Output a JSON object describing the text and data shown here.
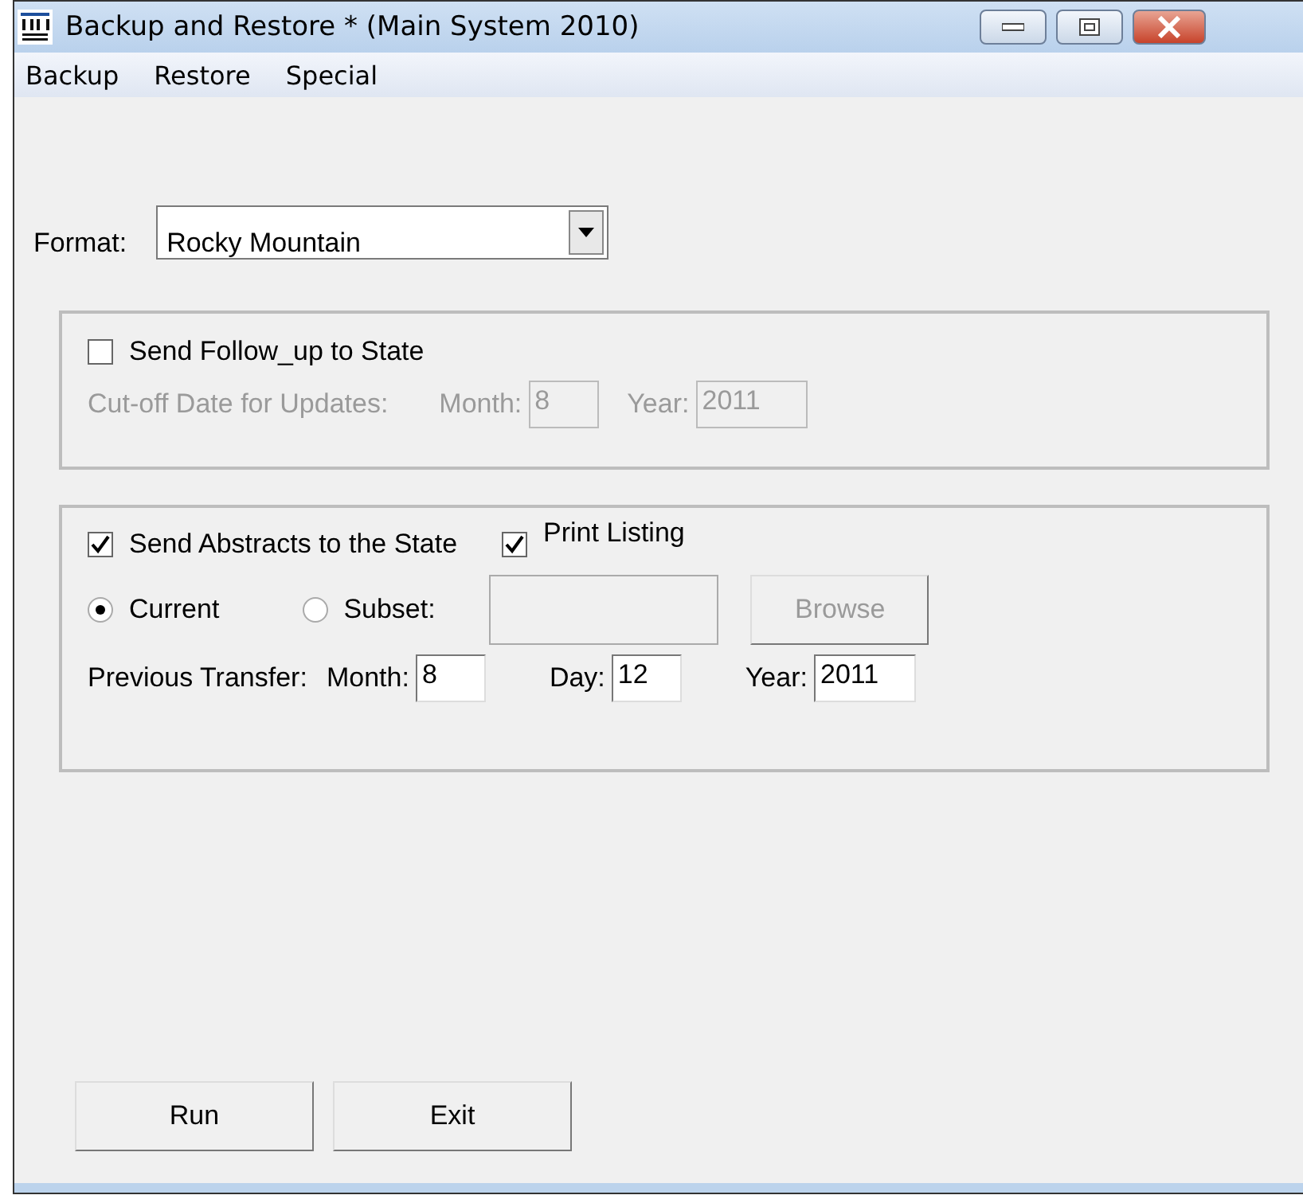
{
  "window": {
    "title": "Backup and Restore *  (Main System 2010)"
  },
  "menu": [
    "Backup",
    "Restore",
    "Special"
  ],
  "format": {
    "label": "Format:",
    "value": "Rocky Mountain"
  },
  "follow_up": {
    "label": "Send Follow_up to State",
    "checked": false,
    "date_row": {
      "label": "Cut-off Date for Updates:",
      "disabled": true,
      "fields": [
        {
          "label": "Month:",
          "value": "8"
        },
        {
          "label": "Year:",
          "value": "2011"
        }
      ]
    }
  },
  "abstracts": {
    "send": {
      "label": "Send Abstracts to the State",
      "checked": true
    },
    "print": {
      "label": "Print Listing",
      "checked": true
    },
    "options": [
      {
        "label": "Current",
        "selected": true
      },
      {
        "label": "Subset:",
        "selected": false
      }
    ],
    "subset_field": {
      "disabled": true
    },
    "browse": {
      "label": "Browse",
      "disabled": true
    },
    "date_row": {
      "label": "Previous Transfer:",
      "disabled": false,
      "fields": [
        {
          "label": "Month:",
          "value": "8"
        },
        {
          "label": "Day:",
          "value": "12"
        },
        {
          "label": "Year:",
          "value": "2011"
        }
      ]
    }
  },
  "buttons": [
    "Run",
    "Exit"
  ]
}
